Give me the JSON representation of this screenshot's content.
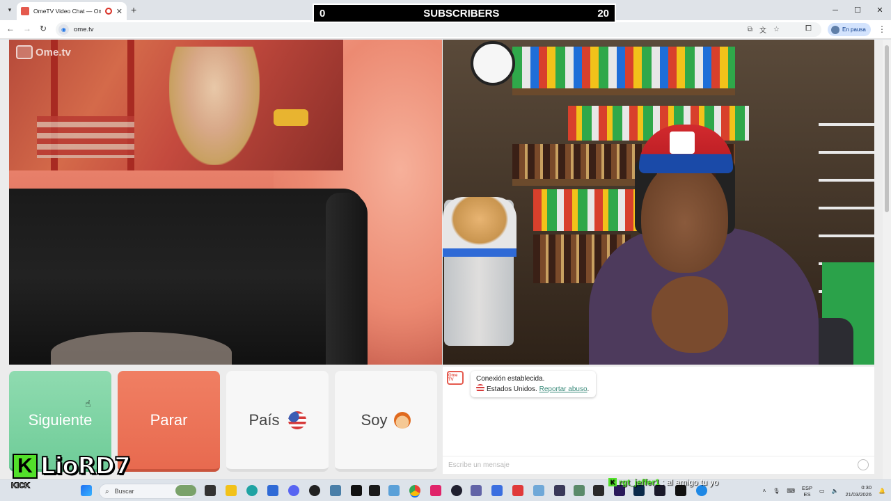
{
  "browser": {
    "tab_title": "OmeTV Video Chat — Ome",
    "new_tab_symbol": "+",
    "url": "ome.tv",
    "profile_label": "En pausa",
    "window_controls": [
      "─",
      "☐",
      "✕"
    ]
  },
  "overlay": {
    "subs_current": "0",
    "subs_label": "SUBSCRIBERS",
    "subs_goal": "20",
    "streamer_badge": "K",
    "streamer_name": "LioRD7",
    "platform_label": "KICK",
    "chat_badge": "K",
    "chat_user": "rgt_jeffer1",
    "chat_message": ": al amigo tu yo"
  },
  "app": {
    "logo_text": "Ome.tv",
    "chat_logo_text": "Ome TV",
    "buttons": {
      "next": "Siguiente",
      "stop": "Parar",
      "country": "País",
      "gender": "Soy"
    },
    "chat": {
      "status_line": "Conexión establecida.",
      "country_text": "Estados Unidos.",
      "report_link": "Reportar abuso",
      "report_suffix": ".",
      "input_placeholder": "Escribe un mensaje"
    }
  },
  "taskbar": {
    "search_placeholder": "Buscar",
    "lang_top": "ESP",
    "lang_bottom": "ES",
    "time": "0:30",
    "date": "21/03/2026"
  },
  "colors": {
    "next": "#7dd3a3",
    "stop": "#ec7459",
    "kick_green": "#52e02a"
  }
}
